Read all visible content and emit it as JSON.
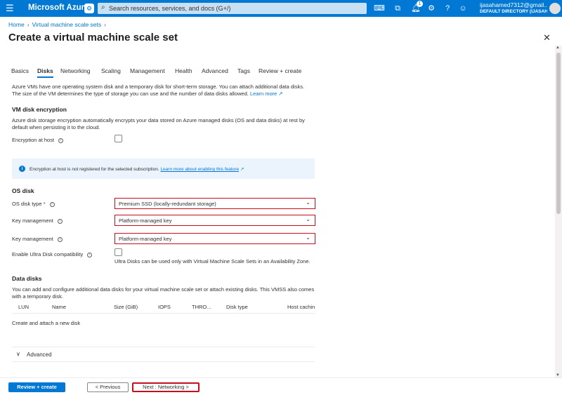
{
  "topbar": {
    "menu_icon": "hamburger-icon",
    "brand": "Microsoft Azure",
    "search_placeholder": "Search resources, services, and docs (G+/)",
    "notifications_count": "1",
    "user_email": "ijasahamed7312@gmail....",
    "user_directory": "DEFAULT DIRECTORY (IJASAHAM..."
  },
  "breadcrumb": {
    "home": "Home",
    "vmss": "Virtual machine scale sets"
  },
  "page": {
    "title": "Create a virtual machine scale set",
    "more": "···",
    "close": "✕"
  },
  "tabs": [
    "Basics",
    "Disks",
    "Networking",
    "Scaling",
    "Management",
    "Health",
    "Advanced",
    "Tags",
    "Review + create"
  ],
  "intro": {
    "line1": "Azure VMs have one operating system disk and a temporary disk for short-term storage. You can attach additional data disks.",
    "line2": "The size of the VM determines the type of storage you can use and the number of data disks allowed.",
    "learn_more": "Learn more"
  },
  "encryption": {
    "heading": "VM disk encryption",
    "desc1": "Azure disk storage encryption automatically encrypts your data stored on Azure managed disks (OS and data disks) at rest by",
    "desc2": "default when persisting it to the cloud.",
    "host_label": "Encryption at host",
    "banner_text": "Encryption at host is not registered for the selected subscription.",
    "banner_link": "Learn more about enabling this feature"
  },
  "os_disk": {
    "heading": "OS disk",
    "type_label": "OS disk type",
    "type_value": "Premium SSD (locally-redundant storage)",
    "key_label_1": "Key management",
    "key_value_1": "Platform-managed key",
    "key_label_2": "Key management",
    "key_value_2": "Platform-managed key",
    "ultra_label": "Enable Ultra Disk compatibility",
    "ultra_note": "Ultra Disks can be used only with Virtual Machine Scale Sets in an Availability Zone."
  },
  "data_disks": {
    "heading": "Data disks",
    "desc1": "You can add and configure additional data disks for your virtual machine scale set or attach existing disks. This VMSS also comes",
    "desc2": "with a temporary disk.",
    "columns": [
      "LUN",
      "Name",
      "Size (GiB)",
      "IOPS",
      "THRO...",
      "Disk type",
      "Host cachin"
    ],
    "create_link": "Create and attach a new disk"
  },
  "advanced": {
    "label": "Advanced"
  },
  "footer": {
    "review": "Review + create",
    "previous": "< Previous",
    "next": "Next : Networking >"
  },
  "colors": {
    "accent": "#0078d4",
    "highlight": "#c50f1f"
  }
}
